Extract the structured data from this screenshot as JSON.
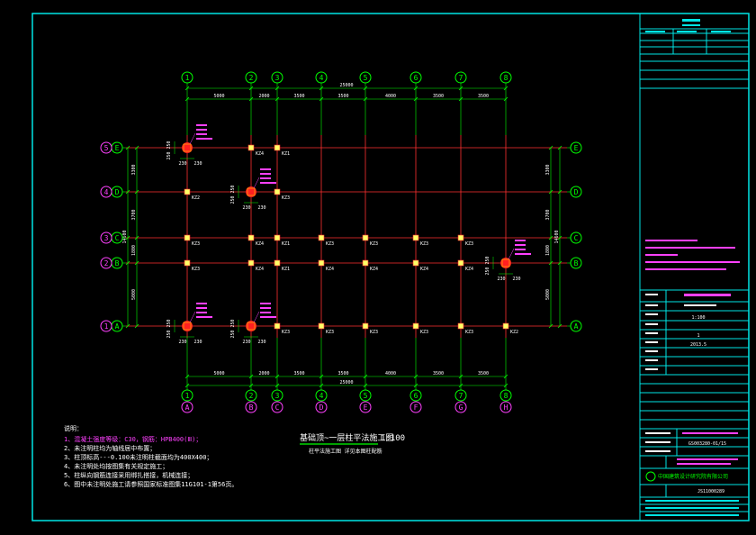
{
  "drawing": {
    "title": "基础顶~一层柱平法施工图",
    "scale": "1:100",
    "subtitle": "柱平法施工图 详见本图柱配筋"
  },
  "grid": {
    "x_labels": [
      "1",
      "2",
      "3",
      "4",
      "5",
      "6",
      "7",
      "8"
    ],
    "x_sub_labels": [
      "A",
      "B",
      "C",
      "D",
      "E",
      "F",
      "G",
      "H"
    ],
    "y_labels": [
      "E",
      "D",
      "C",
      "B",
      "A"
    ],
    "y_circle_labels": [
      "5",
      "4",
      "3",
      "2",
      "1"
    ],
    "x_spacings": [
      "5000",
      "2000",
      "3500",
      "3500",
      "4000",
      "3500",
      "3500"
    ],
    "x_total": "25000",
    "x_total_bottom": "25000",
    "y_spacings": [
      "3300",
      "3700",
      "1800",
      "5000"
    ],
    "y_total": "14600"
  },
  "column_labels": [
    {
      "g": "2E",
      "t": "KZ4"
    },
    {
      "g": "3E",
      "t": "KZ1"
    },
    {
      "g": "1D",
      "t": "KZ2"
    },
    {
      "g": "3D",
      "t": "KZ3"
    },
    {
      "g": "1C",
      "t": "KZ3"
    },
    {
      "g": "2C",
      "t": "KZ4"
    },
    {
      "g": "3C",
      "t": "KZ1"
    },
    {
      "g": "4C",
      "t": "KZ3"
    },
    {
      "g": "5C",
      "t": "KZ3"
    },
    {
      "g": "6C",
      "t": "KZ3"
    },
    {
      "g": "7C",
      "t": "KZ3"
    },
    {
      "g": "1B",
      "t": "KZ3"
    },
    {
      "g": "2B",
      "t": "KZ4"
    },
    {
      "g": "3B",
      "t": "KZ1"
    },
    {
      "g": "4B",
      "t": "KZ4"
    },
    {
      "g": "5B",
      "t": "KZ4"
    },
    {
      "g": "6B",
      "t": "KZ4"
    },
    {
      "g": "7B",
      "t": "KZ4"
    },
    {
      "g": "3A",
      "t": "KZ3"
    },
    {
      "g": "4A",
      "t": "KZ3"
    },
    {
      "g": "5A",
      "t": "KZ3"
    },
    {
      "g": "6A",
      "t": "KZ3"
    },
    {
      "g": "7A",
      "t": "KZ3"
    },
    {
      "g": "8A",
      "t": "KZ2"
    }
  ],
  "column_dims": {
    "a": "230",
    "b": "230",
    "c": "250"
  },
  "notes": {
    "heading": "说明：",
    "items": [
      "1、混凝土强度等级：C30，钢筋：HPB400(Ⅲ)；",
      "2、未注明柱均为轴线居中布置；",
      "3、柱顶标高---0.100未注明柱截面均为400X400；",
      "4、未注明处均按图集有关规定施工；",
      "5、柱纵向钢筋连接采用绑扎搭接，机械连接；",
      "6、图中未注明处施工请参照国家标准图集11G101-1第56页。"
    ]
  },
  "title_block": {
    "drawing_no": "JS11000289",
    "date": "2013.5",
    "scale_value": "1:100",
    "sheet": "1",
    "project_no": "GS003280-01/15",
    "company": "中国建筑设计研究院有限公司"
  },
  "colors": {
    "border": "#00e5e5",
    "grid_line": "#ff3030",
    "axis": "#00ff00",
    "label": "#ff40ff",
    "text": "#ffffff",
    "note_red": "#ff3030"
  }
}
